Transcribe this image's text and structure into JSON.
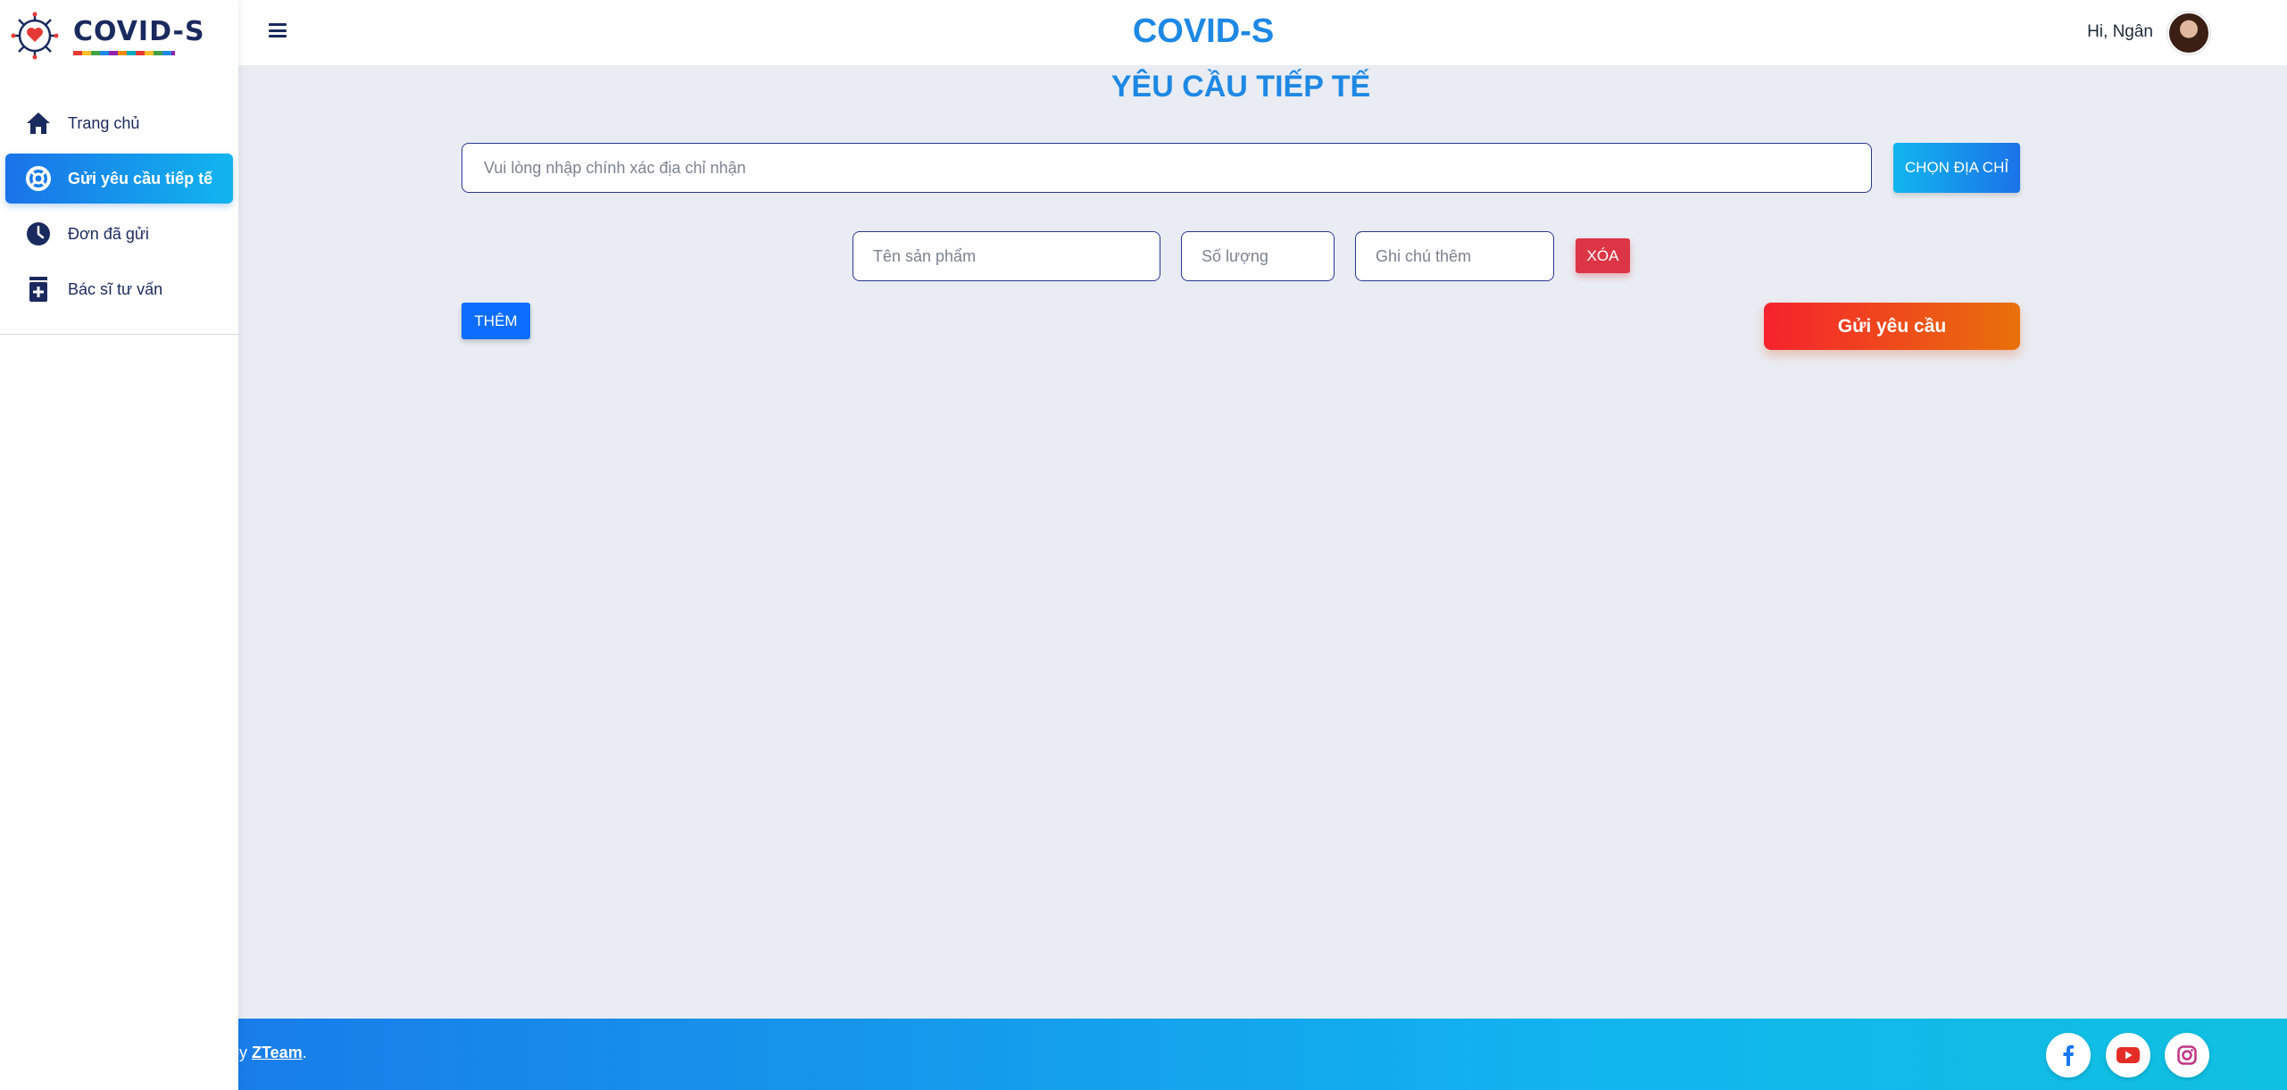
{
  "brand": {
    "name": "COVID-S"
  },
  "sidebar": {
    "items": [
      {
        "label": "Trang chủ",
        "icon": "home-icon",
        "active": false
      },
      {
        "label": "Gửi yêu cầu tiếp tế",
        "icon": "lifebuoy-icon",
        "active": true
      },
      {
        "label": "Đơn đã gửi",
        "icon": "clock-icon",
        "active": false
      },
      {
        "label": "Bác sĩ tư vấn",
        "icon": "medical-kit-icon",
        "active": false
      }
    ]
  },
  "header": {
    "title": "COVID-S",
    "greeting": "Hi, Ngân"
  },
  "main": {
    "title": "YÊU CẦU TIẾP TẾ",
    "address": {
      "placeholder": "Vui lòng nhập chính xác địa chỉ nhận",
      "value": ""
    },
    "choose_address_label": "CHỌN ĐỊA CHỈ",
    "item_row": {
      "product_placeholder": "Tên sản phẩm",
      "quantity_placeholder": "Số lượng",
      "note_placeholder": "Ghi chú thêm",
      "delete_label": "XÓA"
    },
    "add_label": "THÊM",
    "submit_label": "Gửi yêu cầu"
  },
  "footer": {
    "prefix": "by ",
    "team": "ZTeam",
    "suffix": ".",
    "social": [
      "facebook-icon",
      "youtube-icon",
      "instagram-icon"
    ]
  },
  "colors": {
    "accent": "#1e88e5",
    "navy": "#1b2a5e",
    "danger": "#dc3545",
    "primary": "#0d6efd",
    "background": "#e9edf3"
  }
}
